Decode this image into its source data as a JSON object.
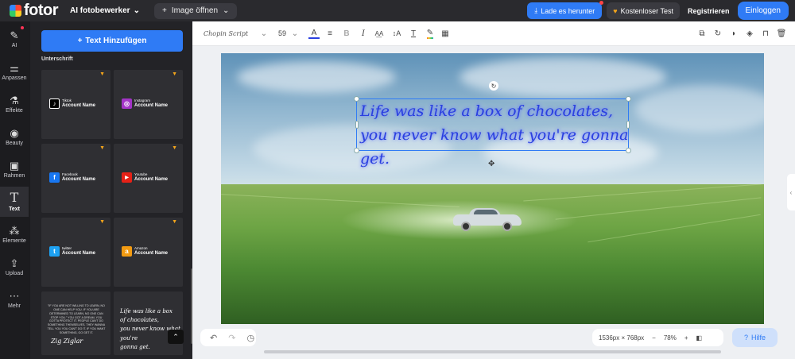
{
  "header": {
    "logo_text": "fotor",
    "tool_dropdown": "AI fotobewerker",
    "open_image": "Image öffnen",
    "download": "Lade es herunter",
    "trial": "Kostenloser Test",
    "register": "Registrieren",
    "login": "Einloggen"
  },
  "rail": {
    "items": [
      {
        "label": "AI",
        "icon": "magic-wand-icon"
      },
      {
        "label": "Anpassen",
        "icon": "sliders-icon"
      },
      {
        "label": "Effekte",
        "icon": "flask-icon"
      },
      {
        "label": "Beauty",
        "icon": "eye-icon"
      },
      {
        "label": "Rahmen",
        "icon": "frame-icon"
      },
      {
        "label": "Text",
        "icon": "text-icon"
      },
      {
        "label": "Elemente",
        "icon": "shapes-icon"
      },
      {
        "label": "Upload",
        "icon": "upload-icon"
      },
      {
        "label": "Mehr",
        "icon": "more-icon"
      }
    ]
  },
  "panel": {
    "add_text": "Text Hinzufügen",
    "subheading": "Unterschrift",
    "tiles": [
      {
        "brand": "Tiktok",
        "account": "Account Name",
        "color": "#000000",
        "glyph": "♪"
      },
      {
        "brand": "Instagram",
        "account": "Account Name",
        "color": "#a334c7",
        "glyph": "◎"
      },
      {
        "brand": "Facebook",
        "account": "Account Name",
        "color": "#1877f2",
        "glyph": "f"
      },
      {
        "brand": "Youtube",
        "account": "Account Name",
        "color": "#e62117",
        "glyph": "▶"
      },
      {
        "brand": "twitter",
        "account": "Account Name",
        "color": "#1da1f2",
        "glyph": "t"
      },
      {
        "brand": "Amazon",
        "account": "Account Name",
        "color": "#f29b12",
        "glyph": "a"
      }
    ],
    "quote_tile": "\"IF YOU ARE NOT WILLING TO LEARN, NO ONE CAN HELP YOU. IF YOU ARE DETERMINED TO LEARN, NO ONE CAN STOP YOU.\" YOU GOT A DREAM, YOU GOTTA PROTECT IT. PEOPLE CAN'T DO SOMETHING THEMSELVES, THEY WANNA TELL YOU YOU CAN'T DO IT. IF YOU WANT SOMETHING, GO GET IT.",
    "quote_signature": "Zig Ziglar",
    "script_tile": [
      "Life was like a box",
      "of chocolates,",
      "you never know what you're",
      "gonna get."
    ]
  },
  "toolbar": {
    "font_name": "Chopin Script",
    "font_size": "59"
  },
  "canvas": {
    "text_line1": "Life was like a box of chocolates,",
    "text_line2": "you never know what you're gonna get."
  },
  "bottom": {
    "dimensions": "1536px × 768px",
    "zoom": "78%",
    "help": "Hilfe"
  },
  "colors": {
    "accent": "#2f7bf5",
    "crown": "#f2a41b",
    "text_color": "#2a3fe0"
  }
}
